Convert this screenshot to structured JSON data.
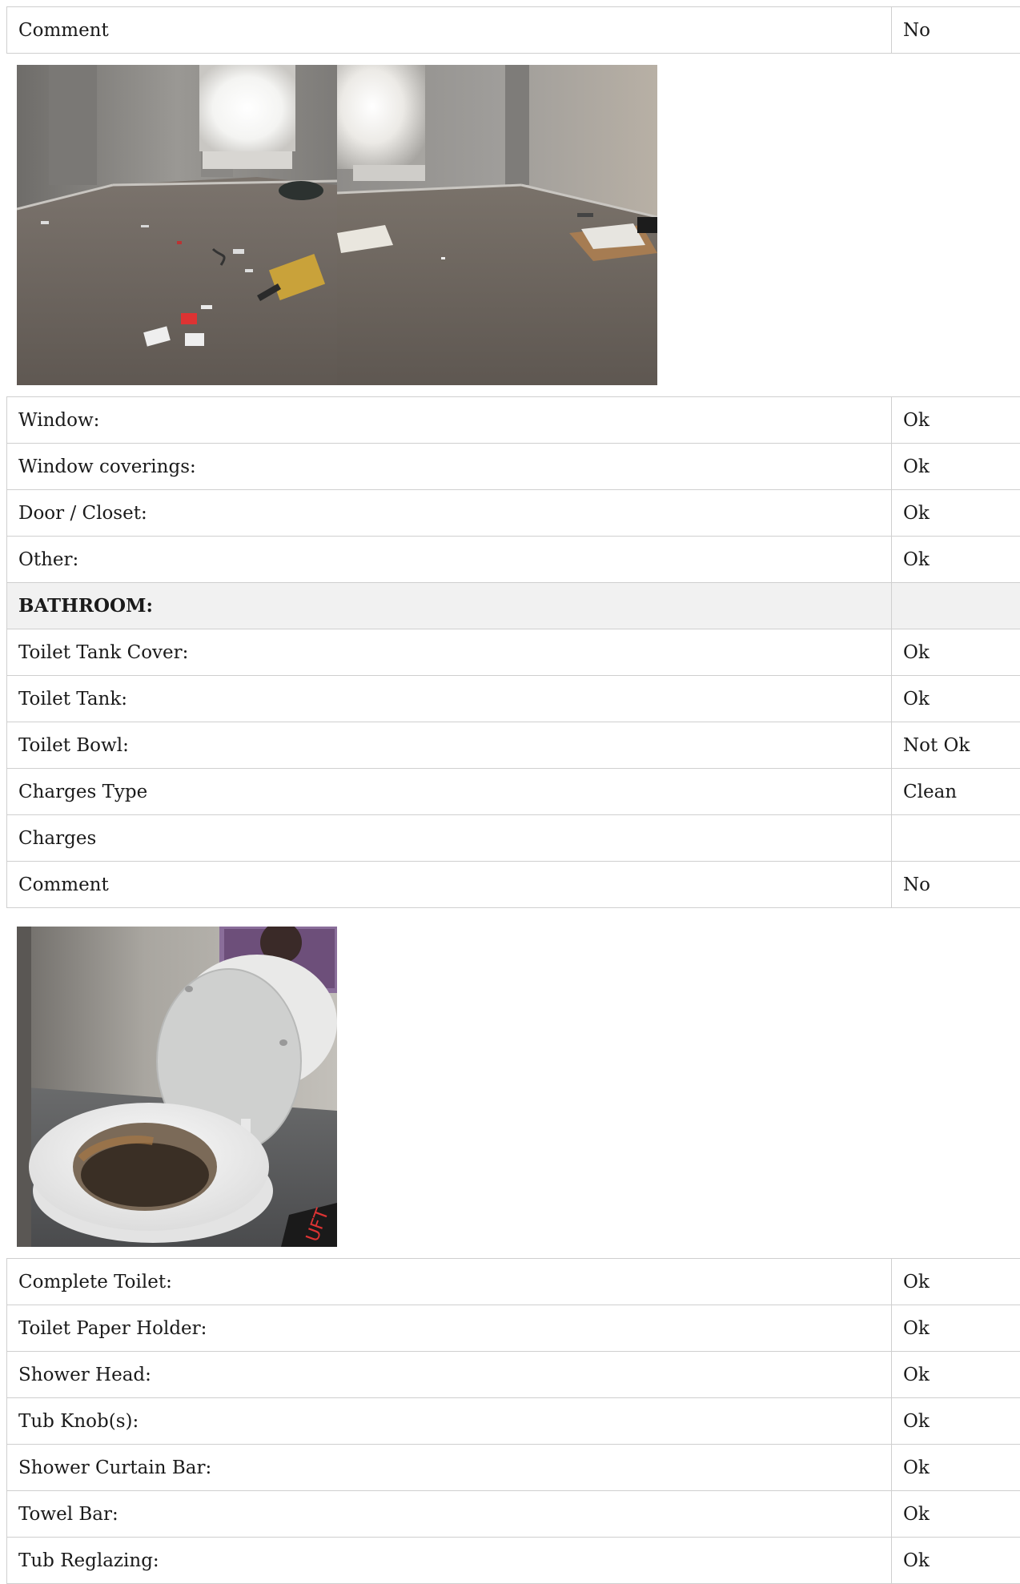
{
  "top_table": {
    "rows": [
      {
        "label": "Comment",
        "value": "No"
      }
    ]
  },
  "photos_1": [
    {
      "name": "room-photo-left"
    },
    {
      "name": "room-photo-right"
    }
  ],
  "room_table": {
    "rows": [
      {
        "label": "Window:",
        "value": "Ok"
      },
      {
        "label": "Window coverings:",
        "value": "Ok"
      },
      {
        "label": "Door / Closet:",
        "value": "Ok"
      },
      {
        "label": "Other:",
        "value": "Ok"
      }
    ],
    "section_title": "BATHROOM:",
    "bathroom_rows": [
      {
        "label": "Toilet Tank Cover:",
        "value": "Ok"
      },
      {
        "label": "Toilet Tank:",
        "value": "Ok"
      },
      {
        "label": "Toilet Bowl:",
        "value": "Not Ok"
      },
      {
        "label": "Charges Type",
        "value": "Clean"
      },
      {
        "label": "Charges",
        "value": ""
      },
      {
        "label": "Comment",
        "value": "No"
      }
    ]
  },
  "photos_2": [
    {
      "name": "toilet-photo"
    }
  ],
  "bathroom_table_2": {
    "rows": [
      {
        "label": "Complete Toilet:",
        "value": "Ok"
      },
      {
        "label": "Toilet Paper Holder:",
        "value": "Ok"
      },
      {
        "label": "Shower Head:",
        "value": "Ok"
      },
      {
        "label": "Tub Knob(s):",
        "value": "Ok"
      },
      {
        "label": "Shower Curtain Bar:",
        "value": "Ok"
      },
      {
        "label": "Towel Bar:",
        "value": "Ok"
      },
      {
        "label": "Tub Reglazing:",
        "value": "Ok"
      }
    ]
  }
}
